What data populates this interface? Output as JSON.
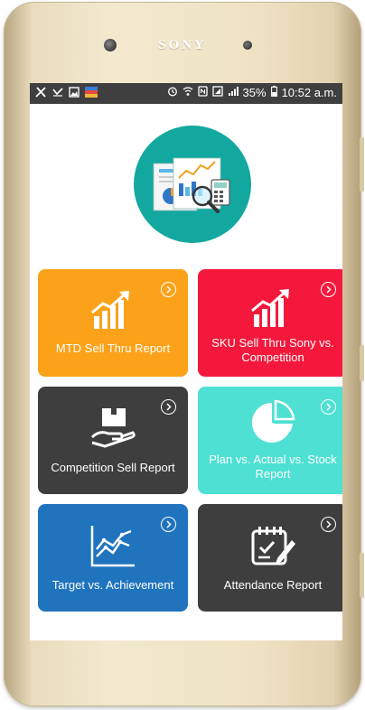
{
  "device": {
    "brand": "SONY"
  },
  "status_bar": {
    "battery": "35%",
    "time": "10:52 a.m.",
    "left_icons": [
      "tools-icon",
      "missed-call-icon",
      "gallery-icon",
      "app-thumbnail-icon"
    ],
    "right_icons": [
      "alarm-icon",
      "wifi-icon",
      "nfc-icon",
      "sim-icon",
      "signal-icon",
      "battery-icon"
    ]
  },
  "header": {
    "logo_icon": "reports-analytics-icon"
  },
  "tiles": [
    {
      "label": "MTD Sell Thru Report",
      "color": "#fba21a",
      "icon": "growth-chart-icon"
    },
    {
      "label": "SKU Sell Thru Sony vs. Competition",
      "color": "#f4193c",
      "icon": "growth-chart-icon"
    },
    {
      "label": "Competition Sell Report",
      "color": "#3e3e3e",
      "icon": "box-in-hand-icon"
    },
    {
      "label": "Plan vs. Actual vs. Stock Report",
      "color": "#4ee0d2",
      "icon": "pie-chart-icon"
    },
    {
      "label": "Target vs. Achievement",
      "color": "#1f74bd",
      "icon": "line-chart-icon"
    },
    {
      "label": "Attendance Report",
      "color": "#3e3e3e",
      "icon": "calendar-edit-icon"
    }
  ]
}
